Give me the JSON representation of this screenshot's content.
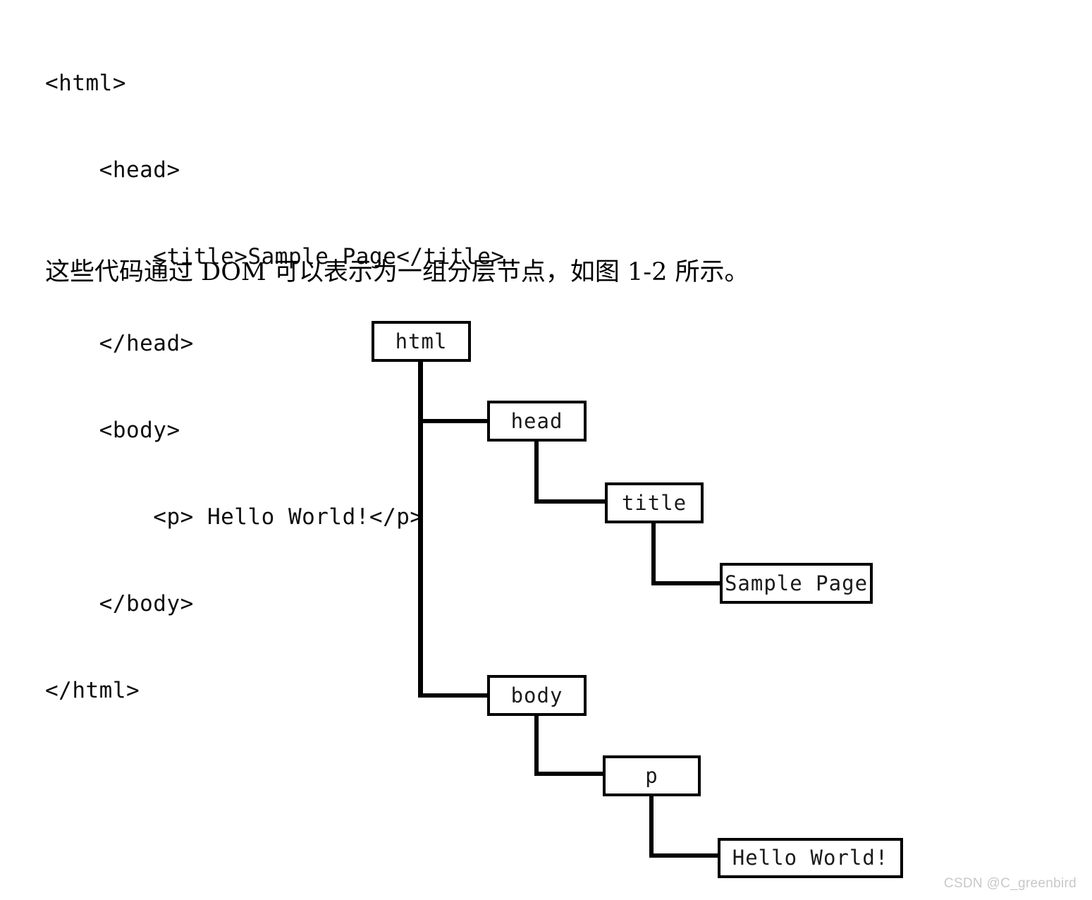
{
  "code_listing": {
    "lines": [
      "<html>",
      "    <head>",
      "        <title>Sample Page</title>",
      "    </head>",
      "    <body>",
      "        <p> Hello World!</p>",
      "    </body>",
      "</html>"
    ]
  },
  "caption": {
    "text": "这些代码通过 DOM 可以表示为一组分层节点，如图 1-2 所示。"
  },
  "diagram": {
    "nodes": {
      "html": "html",
      "head": "head",
      "title": "title",
      "sample_page": "Sample Page",
      "body": "body",
      "p": "p",
      "hello_world": "Hello World!"
    }
  },
  "watermark": {
    "text": "CSDN @C_greenbird"
  },
  "colors": {
    "background": "#ffffff",
    "ink": "#000000",
    "watermark": "#c8c8c8"
  }
}
